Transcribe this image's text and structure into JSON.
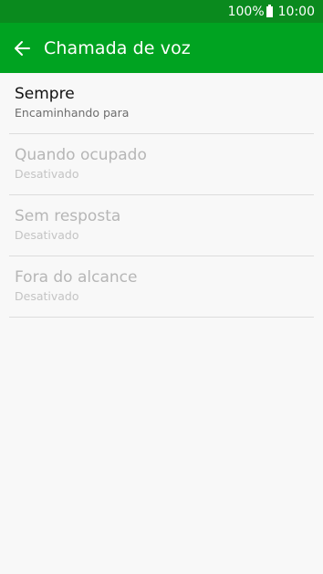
{
  "status_bar": {
    "battery": "100%",
    "time": "10:00",
    "icons": [
      "battery-icon"
    ]
  },
  "app_bar": {
    "title": "Chamada de voz",
    "back_icon": "arrow-left-icon"
  },
  "items": [
    {
      "title": "Sempre",
      "subtitle": "Encaminhando para",
      "enabled": true
    },
    {
      "title": "Quando ocupado",
      "subtitle": "Desativado",
      "enabled": false
    },
    {
      "title": "Sem resposta",
      "subtitle": "Desativado",
      "enabled": false
    },
    {
      "title": "Fora do alcance",
      "subtitle": "Desativado",
      "enabled": false
    }
  ],
  "colors": {
    "status_bar": "#0a8a1e",
    "app_bar": "#00a321",
    "background": "#f8f8f8"
  }
}
